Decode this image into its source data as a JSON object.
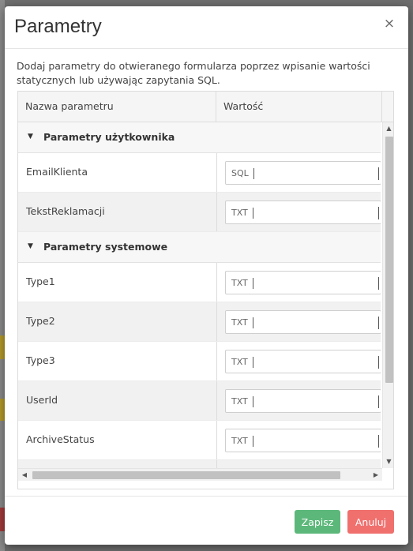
{
  "modal": {
    "title": "Parametry",
    "close_symbol": "×",
    "description": "Dodaj parametry do otwieranego formularza poprzez wpisanie wartości statycznych lub używając zapytania SQL."
  },
  "grid": {
    "columns": [
      "Nazwa parametru",
      "Wartość"
    ],
    "groups": [
      {
        "label": "Parametry użytkownika",
        "params": [
          {
            "name": "EmailKlienta",
            "type": "SQL"
          },
          {
            "name": "TekstReklamacji",
            "type": "TXT"
          }
        ]
      },
      {
        "label": "Parametry systemowe",
        "params": [
          {
            "name": "Type1",
            "type": "TXT"
          },
          {
            "name": "Type2",
            "type": "TXT"
          },
          {
            "name": "Type3",
            "type": "TXT"
          },
          {
            "name": "UserId",
            "type": "TXT"
          },
          {
            "name": "ArchiveStatus",
            "type": "TXT"
          }
        ]
      }
    ]
  },
  "footer": {
    "save_label": "Zapisz",
    "cancel_label": "Anuluj"
  },
  "colors": {
    "save": "#5cb87a",
    "cancel": "#f0706e",
    "backdrop": "#6e6e6e"
  }
}
